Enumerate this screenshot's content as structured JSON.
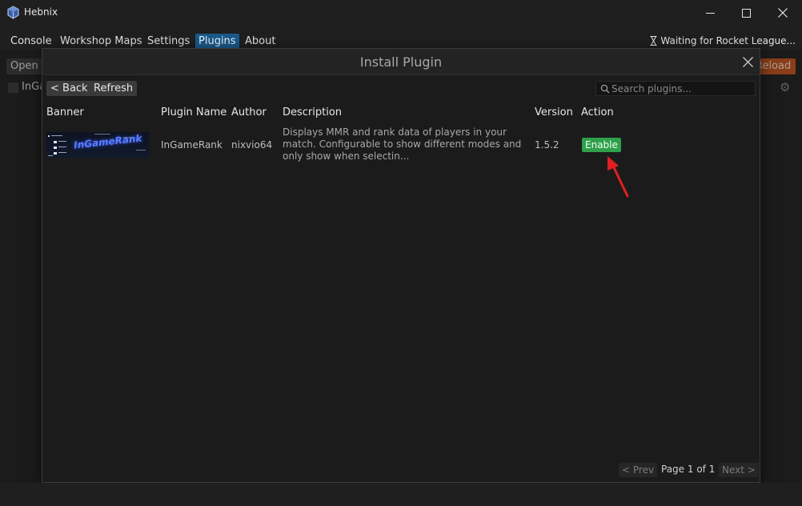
{
  "window": {
    "title": "Hebnix",
    "icon": "hebnix-app-icon",
    "controls": {
      "minimize": "minimize-icon",
      "maximize": "maximize-icon",
      "close": "close-icon"
    }
  },
  "menu": {
    "items": [
      {
        "label": "Console"
      },
      {
        "label": "Workshop Maps"
      },
      {
        "label": "Settings"
      },
      {
        "label": "Plugins",
        "active": true
      },
      {
        "label": "About"
      }
    ],
    "active_color": "#1a5a8a"
  },
  "status": {
    "text": "Waiting for Rocket League...",
    "icon": "hourglass-icon"
  },
  "background": {
    "open_button": "Open F",
    "reload_button": "Reload",
    "reload_color": "#c9541a",
    "row_label": "InGa"
  },
  "modal": {
    "title": "Install Plugin",
    "back_button": "< Back",
    "refresh_button": "Refresh",
    "search": {
      "placeholder": "Search plugins..."
    },
    "columns": [
      "Banner",
      "Plugin Name",
      "Author",
      "Description",
      "Version",
      "Action"
    ],
    "rows": [
      {
        "banner_text": "InGameRank",
        "name": "InGameRank",
        "author": "nixvio64",
        "description": "Displays MMR and rank data of players in your match. Configurable to show different modes and only show when selectin...",
        "version": "1.5.2",
        "action": "Enable",
        "action_color": "#2fa04a"
      }
    ],
    "pagination": {
      "prev": "< Prev",
      "page_text": "Page 1 of 1",
      "next": "Next >"
    }
  },
  "annotation": {
    "arrow_color": "#e02020"
  }
}
